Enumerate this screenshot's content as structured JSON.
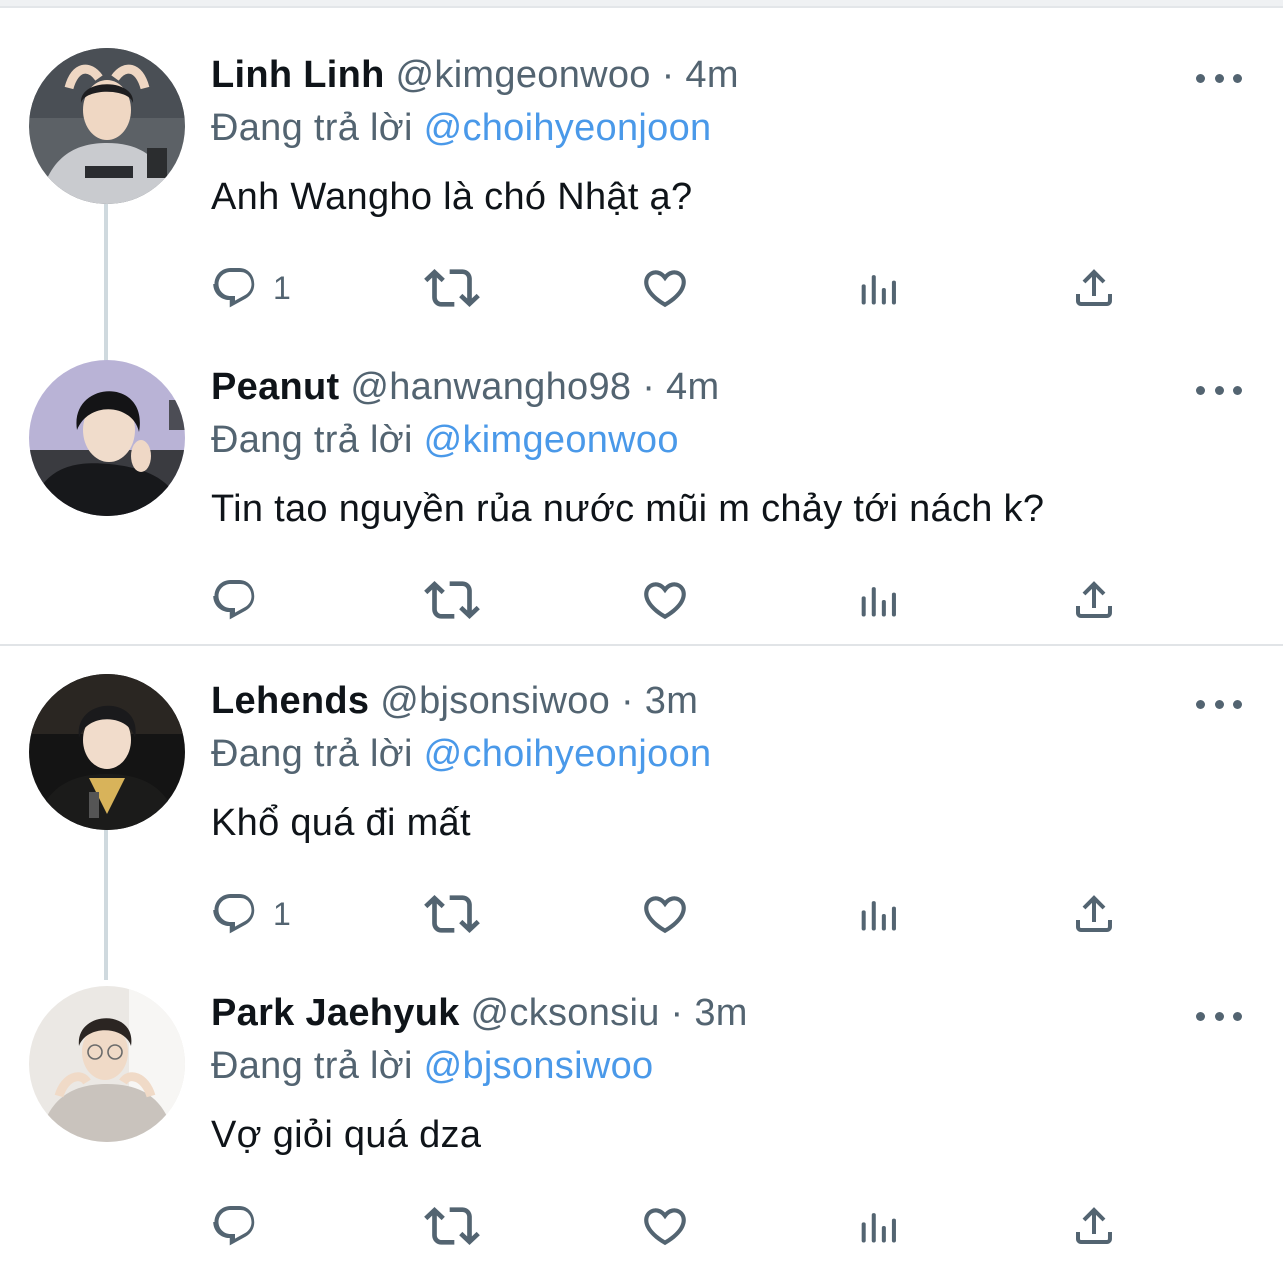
{
  "colors": {
    "name": "#0f1419",
    "meta": "#536471",
    "mention": "#4a99e9",
    "divider": "#e1e4e7",
    "thread_line": "#cfd9de"
  },
  "icons": {
    "reply": "reply-icon",
    "retweet": "retweet-icon",
    "like": "heart-icon",
    "analytics": "analytics-icon",
    "share": "share-icon",
    "more": "more-icon"
  },
  "tweets": [
    {
      "name": "Linh Linh",
      "handle": "@kimgeonwoo",
      "sep": "·",
      "time": "4m",
      "reply_prefix": "Đang trả lời",
      "reply_to": "@choihyeonjoon",
      "text": "Anh Wangho là chó Nhật ạ?",
      "reply_count": "1"
    },
    {
      "name": "Peanut",
      "handle": "@hanwangho98",
      "sep": "·",
      "time": "4m",
      "reply_prefix": "Đang trả lời",
      "reply_to": "@kimgeonwoo",
      "text": "Tin tao nguyền rủa nước mũi m chảy tới nách k?",
      "reply_count": ""
    },
    {
      "name": "Lehends",
      "handle": "@bjsonsiwoo",
      "sep": "·",
      "time": "3m",
      "reply_prefix": "Đang trả lời",
      "reply_to": "@choihyeonjoon",
      "text": "Khổ quá đi mất",
      "reply_count": "1"
    },
    {
      "name": "Park Jaehyuk",
      "handle": "@cksonsiu",
      "sep": "·",
      "time": "3m",
      "reply_prefix": "Đang trả lời",
      "reply_to": "@bjsonsiwoo",
      "text": "Vợ giỏi quá dza",
      "reply_count": ""
    }
  ]
}
